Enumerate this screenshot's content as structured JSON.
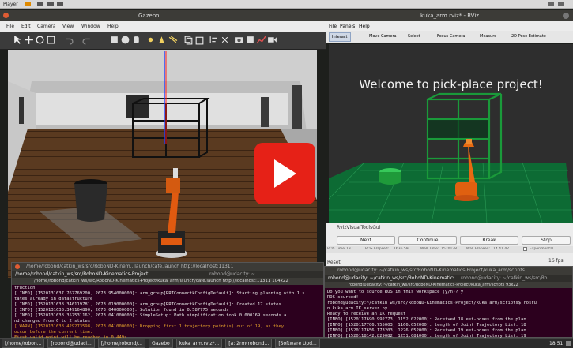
{
  "host_bar": {
    "menu_label": "Player",
    "right_icons": [
      "tray-icon",
      "tray-icon",
      "tray-icon"
    ]
  },
  "gazebo": {
    "title": "Gazebo",
    "menu": [
      "File",
      "Edit",
      "Camera",
      "View",
      "Window",
      "Help"
    ]
  },
  "rviz": {
    "title": "kuka_arm.rviz* - RViz",
    "menu": [
      "File",
      "Panels",
      "Help"
    ],
    "toolbar": [
      "Interact",
      "Move Camera",
      "Select",
      "Focus Camera",
      "Measure",
      "2D Pose Estimate"
    ],
    "welcome_text": "Welcome to pick-place project!",
    "panel_title": "RvizVisualToolsGui",
    "buttons": [
      "Next",
      "Continue",
      "Break",
      "Stop"
    ],
    "ros_time_label": "ROS Time:",
    "ros_time_value": "137",
    "ros_elapsed_label": "ROS Elapsed:",
    "ros_elapsed_value": "1636.59",
    "wall_time_label": "Wall Time:",
    "wall_time_value": "1520128",
    "wall_elapsed_label": "Wall Elapsed:",
    "wall_elapsed_value": "14.41.42",
    "experimental_label": "Experimental",
    "reset_label": "Reset",
    "fps": "16 fps"
  },
  "term1": {
    "title_back": "/home/robond/catkin_ws/src/RoboND-Kinem...launch/cafe.launch http://localhost:11311",
    "tab_left": "/home/robond/catkin_ws/src/RoboND-Kinematics-Project",
    "tab_right": "robond@udacity: ~",
    "title_front": "/home/robond/catkin_ws/src/RoboND-Kinematics-Project/kuka_arm/launch/cafe.launch http://localhost:11311 104x22",
    "lines": [
      {
        "text": "truction",
        "color": "#e8e8e8"
      },
      {
        "text": "[ INFO] [1520131637.767769200, 2673.954000000]: arm_group[RRTConnectkConfigDefault]: Starting planning with 1 s",
        "color": "#e8e8e8"
      },
      {
        "text": "tates already in datastructure",
        "color": "#e8e8e8"
      },
      {
        "text": "[ INFO] [1520131638.346119781, 2673.019000000]: arm_group[RRTConnectkConfigDefault]: Created 17 states",
        "color": "#e8e8e8"
      },
      {
        "text": "[ INFO] [1520131638.349164890, 2673.040000000]: Solution found in 0.587775 seconds",
        "color": "#e8e8e8"
      },
      {
        "text": "[ INFO] [1520131638.357531162, 2673.041000000]: SimpleSetup: Path simplification took 0.000169 seconds a",
        "color": "#e8e8e8"
      },
      {
        "text": "nd changed from 6 to 2 states",
        "color": "#e8e8e8"
      },
      {
        "text": "[ WARN] [1520131638.429273598, 2673.041000000]: Dropping first 1 trajectory point(s) out of 19, as they",
        "color": "#e6a12b"
      },
      {
        "text": "occur before the current time.",
        "color": "#e6a12b"
      },
      {
        "text": "First valid point will be reached in 0.449s.",
        "color": "#e6a12b"
      }
    ]
  },
  "term2": {
    "title": "robond@udacity: ~/catkin_ws/src/RoboND-Kinematics-Project/kuka_arm/scripts",
    "tab_left": "robond@udacity: ~/catkin_ws/src/RoboND-Kinematics",
    "tab_right": "robond@udacity: ~/catkin_ws/src/Ro",
    "subtitle": "robond@udacity: ~/catkin_ws/src/RoboND-Kinematics-Project/kuka_arm/scripts 93x22",
    "lines": [
      "Do you want to source ROS in this workspace (y/n)? y",
      "ROS sourced!",
      "robond@udacity:~/catkin_ws/src/RoboND-Kinematics-Project/kuka_arm/scripts$ rosru",
      "n kuka_arm IK_server.py",
      "Ready to receive an IK request",
      "[INFO] [1520117690.992773, 1152.022000]: Received 18 eef-poses from the plan",
      "[INFO] [1520117706.755003, 1166.052000]: length of Joint Trajectory List: 18",
      "[INFO] [1520117656.173203, 1226.052000]: Received 19 eef-poses from the plan",
      "[INFO] [1520118142.829082, 1251.081000]: length of Joint Trajectory List: 19"
    ]
  },
  "taskbar": {
    "items": [
      "[/home/robon...",
      "[robond@udaci...",
      "[/home/robond/...",
      "Gazebo",
      "kuka_arm.rviz*...",
      "[a: 2rm(robond...",
      "[Software Upd..."
    ],
    "clock": "18:51"
  }
}
